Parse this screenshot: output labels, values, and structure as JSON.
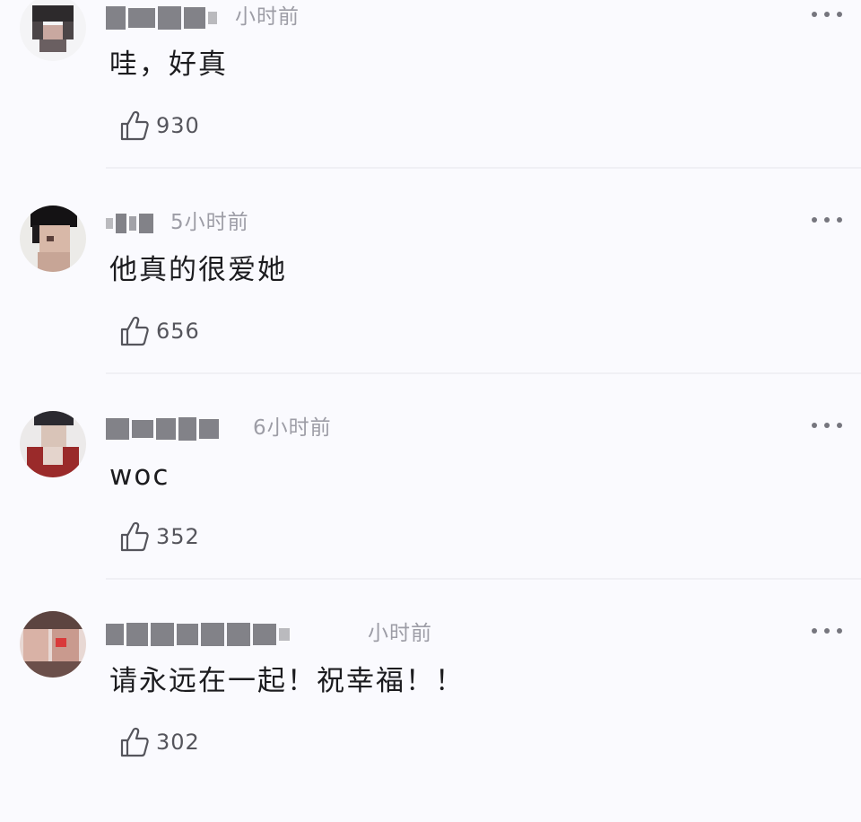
{
  "comments": [
    {
      "time": "小时前",
      "text": "哇，好真",
      "likes": "930",
      "like_icon": "thumbs-up-icon",
      "more_icon": "more-dots-icon"
    },
    {
      "time": "5小时前",
      "text": "他真的很爱她",
      "likes": "656",
      "like_icon": "thumbs-up-icon",
      "more_icon": "more-dots-icon"
    },
    {
      "time": "6小时前",
      "text": "woc",
      "likes": "352",
      "like_icon": "thumbs-up-icon",
      "more_icon": "more-dots-icon"
    },
    {
      "time": "小时前",
      "text": "请永远在一起！祝幸福！！",
      "likes": "302",
      "like_icon": "thumbs-up-icon",
      "more_icon": "more-dots-icon"
    }
  ],
  "colors": {
    "background": "#fafafe",
    "text": "#1c1c1f",
    "muted": "#9d9da6",
    "icon": "#55555c"
  }
}
